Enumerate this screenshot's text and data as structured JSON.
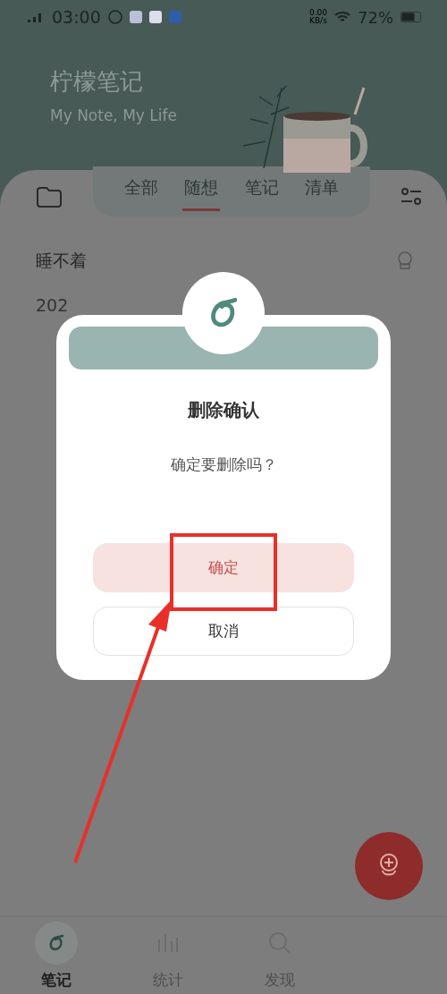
{
  "status_bar": {
    "time": "03:00",
    "network_speed": "0.00\nKB/s",
    "battery": "72%"
  },
  "header": {
    "title": "柠檬笔记",
    "subtitle": "My Note, My Life"
  },
  "tabs": [
    {
      "label": "全部",
      "selected": false
    },
    {
      "label": "随想",
      "selected": true
    },
    {
      "label": "笔记",
      "selected": false
    },
    {
      "label": "清单",
      "selected": false
    }
  ],
  "notes": [
    {
      "title": "睡不着",
      "date": "202"
    }
  ],
  "dialog": {
    "title": "删除确认",
    "message": "确定要删除吗？",
    "buttons": [
      {
        "label": "确定",
        "kind": "confirm"
      },
      {
        "label": "取消",
        "kind": "cancel"
      }
    ]
  },
  "bottom_nav": [
    {
      "label": "笔记",
      "selected": true,
      "kind": "notes"
    },
    {
      "label": "统计",
      "selected": false,
      "kind": "stats"
    },
    {
      "label": "发现",
      "selected": false,
      "kind": "discover"
    }
  ]
}
